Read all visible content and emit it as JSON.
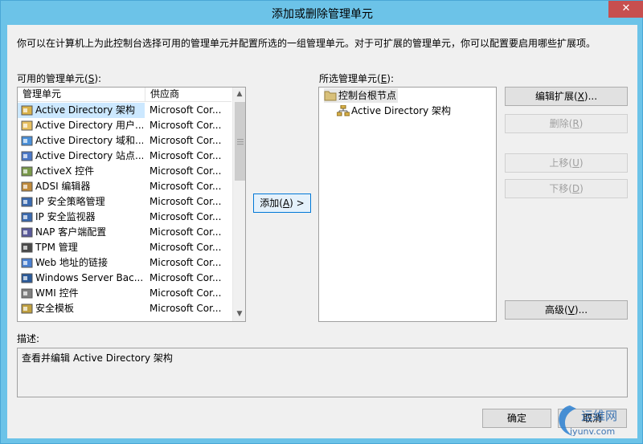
{
  "window": {
    "title": "添加或删除管理单元",
    "close_glyph": "✕"
  },
  "intro": "你可以在计算机上为此控制台选择可用的管理单元并配置所选的一组管理单元。对于可扩展的管理单元，你可以配置要启用哪些扩展项。",
  "available": {
    "label_pre": "可用的管理单元(",
    "label_key": "S",
    "label_post": "):",
    "col_name": "管理单元",
    "col_vendor": "供应商",
    "items": [
      {
        "name": "Active Directory 架构",
        "vendor": "Microsoft Cor...",
        "icon": "ad-schema-icon"
      },
      {
        "name": "Active Directory 用户...",
        "vendor": "Microsoft Cor...",
        "icon": "ad-users-icon"
      },
      {
        "name": "Active Directory 域和...",
        "vendor": "Microsoft Cor...",
        "icon": "ad-domains-icon"
      },
      {
        "name": "Active Directory 站点...",
        "vendor": "Microsoft Cor...",
        "icon": "ad-sites-icon"
      },
      {
        "name": "ActiveX 控件",
        "vendor": "Microsoft Cor...",
        "icon": "activex-icon"
      },
      {
        "name": "ADSI 编辑器",
        "vendor": "Microsoft Cor...",
        "icon": "adsi-edit-icon"
      },
      {
        "name": "IP 安全策略管理",
        "vendor": "Microsoft Cor...",
        "icon": "ipsec-policy-icon"
      },
      {
        "name": "IP 安全监视器",
        "vendor": "Microsoft Cor...",
        "icon": "ipsec-monitor-icon"
      },
      {
        "name": "NAP 客户端配置",
        "vendor": "Microsoft Cor...",
        "icon": "nap-icon"
      },
      {
        "name": "TPM 管理",
        "vendor": "Microsoft Cor...",
        "icon": "tpm-icon"
      },
      {
        "name": "Web 地址的链接",
        "vendor": "Microsoft Cor...",
        "icon": "web-link-icon"
      },
      {
        "name": "Windows Server Bac...",
        "vendor": "Microsoft Cor...",
        "icon": "server-backup-icon"
      },
      {
        "name": "WMI 控件",
        "vendor": "Microsoft Cor...",
        "icon": "wmi-icon"
      },
      {
        "name": "安全模板",
        "vendor": "Microsoft Cor...",
        "icon": "security-template-icon"
      }
    ]
  },
  "add_button": {
    "pre": "添加(",
    "key": "A",
    "post": ") >"
  },
  "selected": {
    "label_pre": "所选管理单元(",
    "label_key": "E",
    "label_post": "):",
    "root": "控制台根节点",
    "child": "Active Directory 架构"
  },
  "buttons": {
    "edit_ext": {
      "pre": "编辑扩展(",
      "key": "X",
      "post": ")..."
    },
    "remove": {
      "pre": "删除(",
      "key": "R",
      "post": ")"
    },
    "move_up": {
      "pre": "上移(",
      "key": "U",
      "post": ")"
    },
    "move_down": {
      "pre": "下移(",
      "key": "D",
      "post": ")"
    },
    "advanced": {
      "pre": "高级(",
      "key": "V",
      "post": ")..."
    },
    "ok": "确定",
    "cancel": "取消"
  },
  "description": {
    "label": "描述:",
    "text": "查看并编辑 Active Directory 架构"
  },
  "watermark": {
    "text_cn": "运维网",
    "text_url": "iyunv.com"
  },
  "colors": {
    "titlebar": "#6cc3e8",
    "selection": "#cce8ff",
    "close": "#c74f4f"
  }
}
